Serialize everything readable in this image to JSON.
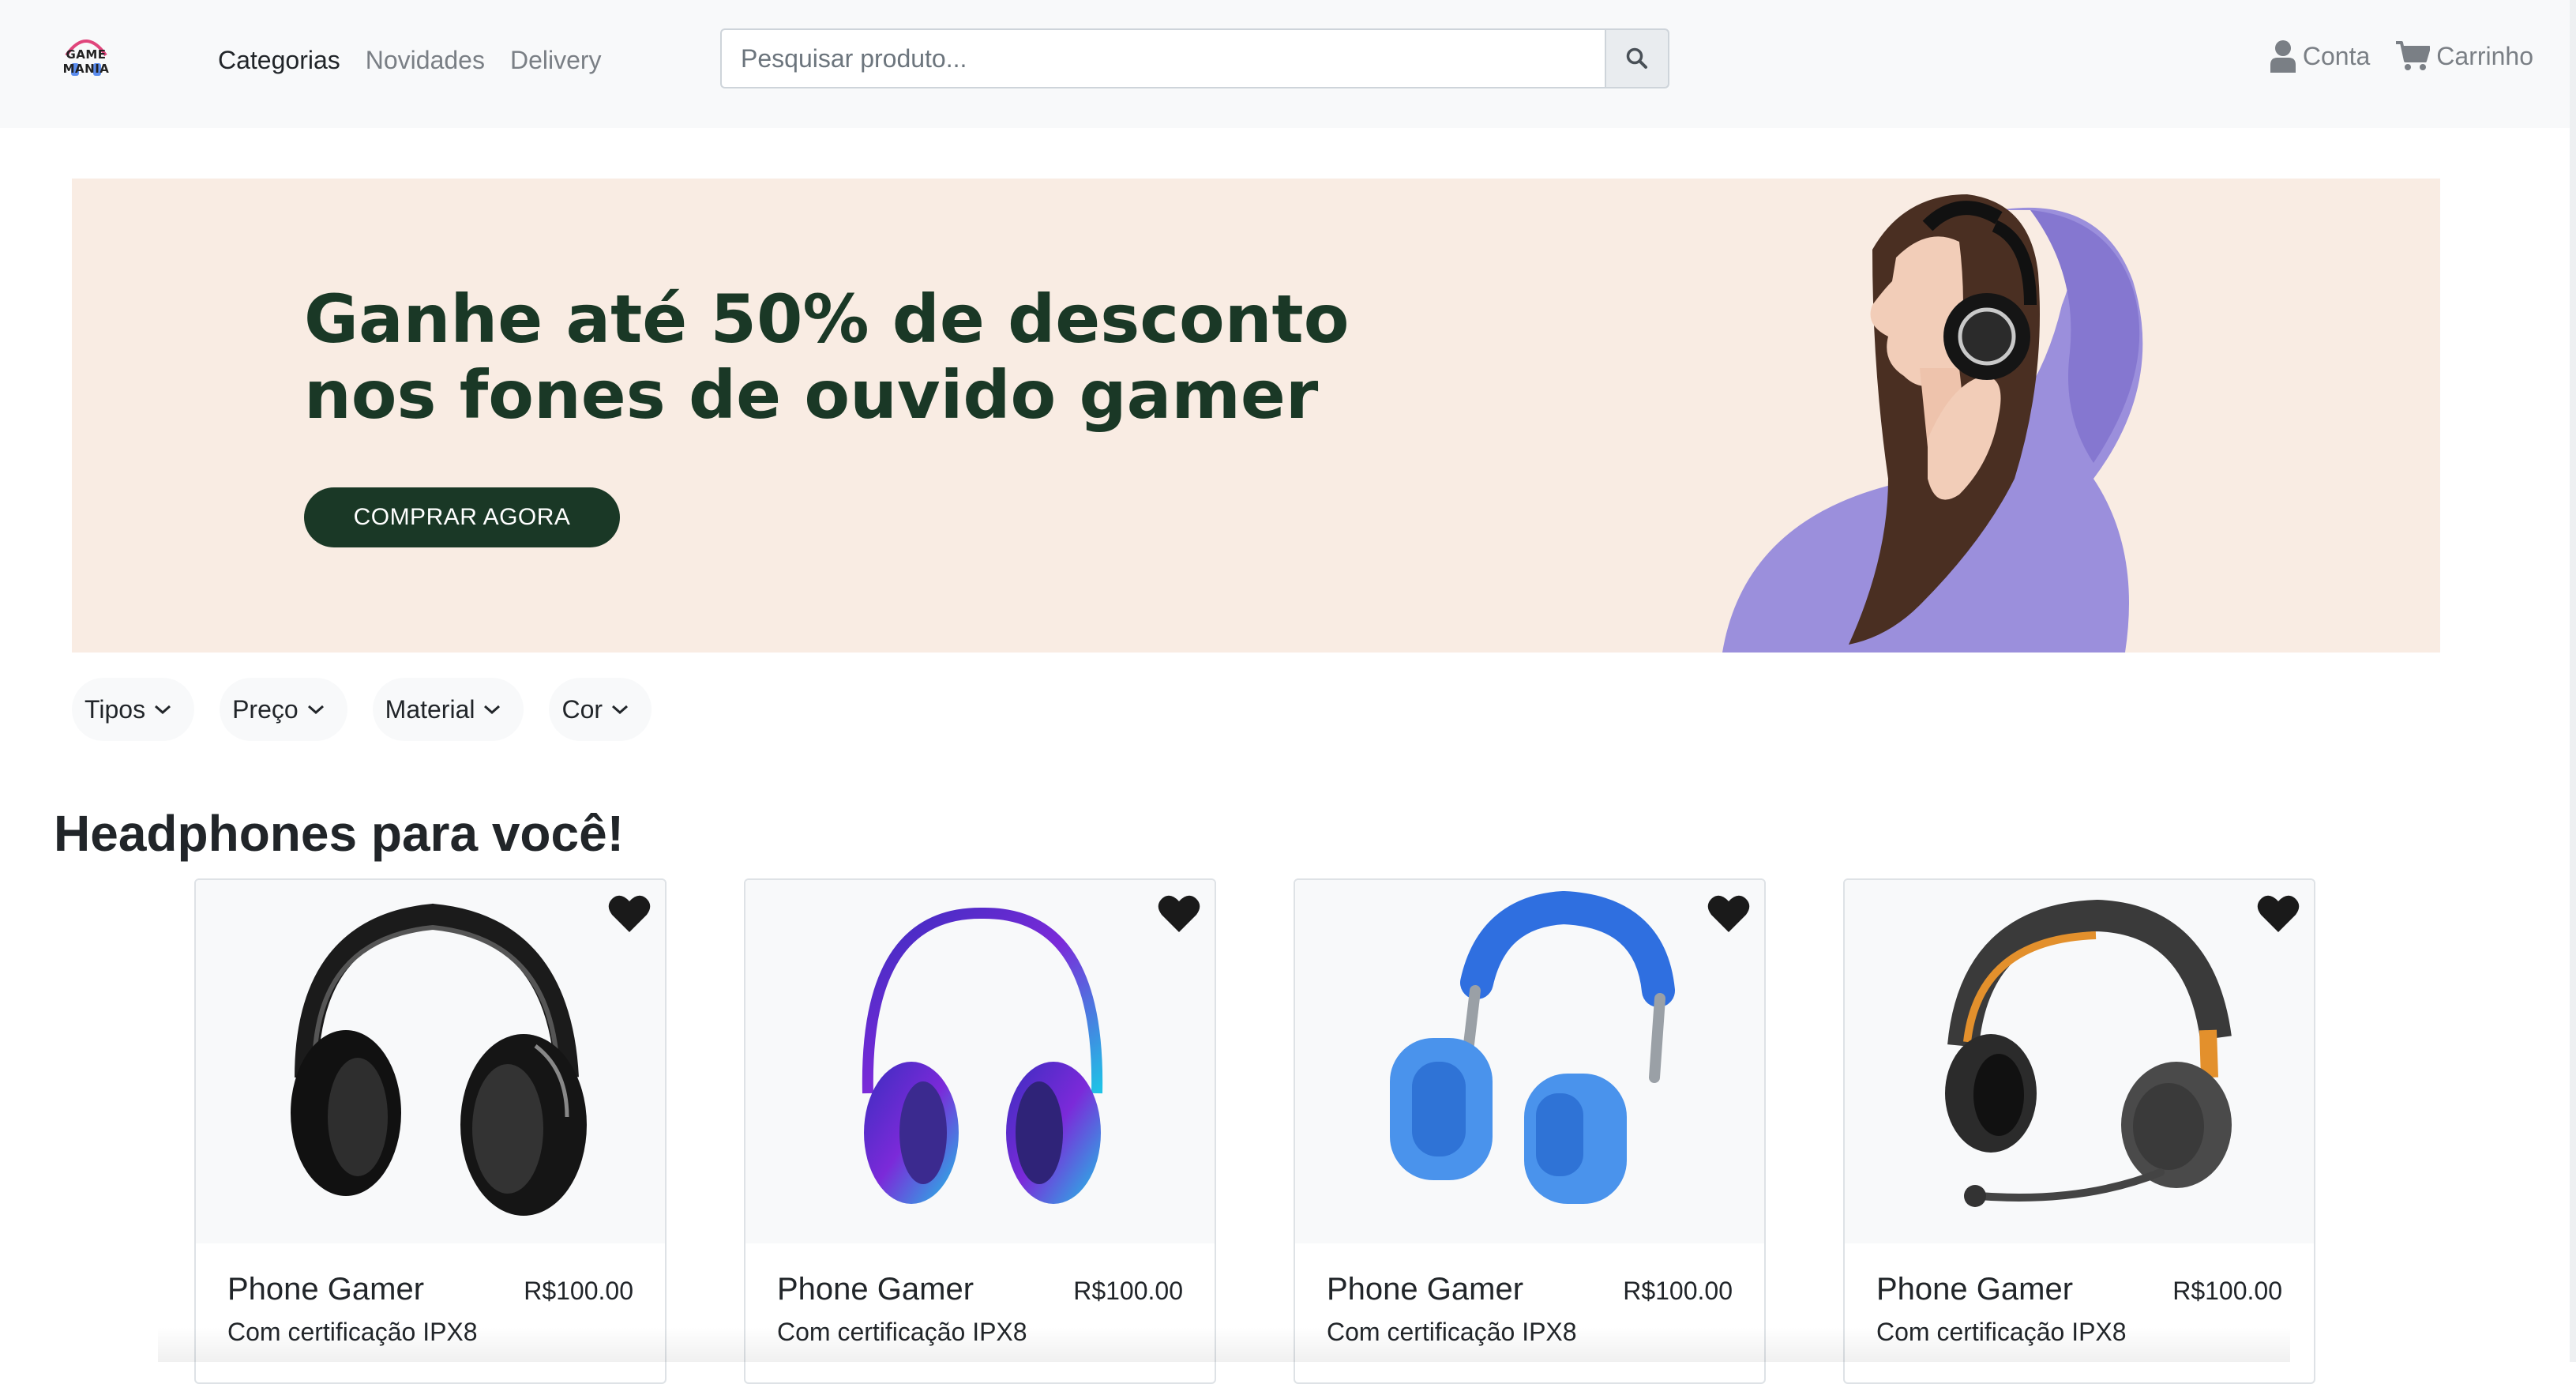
{
  "brand": {
    "logo_text": "GAME MANIA"
  },
  "nav": {
    "links": [
      {
        "label": "Categorias",
        "active": true
      },
      {
        "label": "Novidades",
        "active": false
      },
      {
        "label": "Delivery",
        "active": false
      }
    ],
    "search_placeholder": "Pesquisar produto...",
    "account_label": "Conta",
    "cart_label": "Carrinho"
  },
  "hero": {
    "title": "Ganhe até 50% de desconto\nnos fones de ouvido gamer",
    "button_label": "COMPRAR AGORA"
  },
  "filters": [
    {
      "label": "Tipos"
    },
    {
      "label": "Preço"
    },
    {
      "label": "Material"
    },
    {
      "label": "Cor"
    }
  ],
  "section_title": "Headphones para você!",
  "products": [
    {
      "name": "Phone Gamer",
      "price": "R$100.00",
      "desc": "Com certificação IPX8",
      "icon": "black-headphones"
    },
    {
      "name": "Phone Gamer",
      "price": "R$100.00",
      "desc": "Com certificação IPX8",
      "icon": "purple-headphones"
    },
    {
      "name": "Phone Gamer",
      "price": "R$100.00",
      "desc": "Com certificação IPX8",
      "icon": "blue-headphones"
    },
    {
      "name": "Phone Gamer",
      "price": "R$100.00",
      "desc": "Com certificação IPX8",
      "icon": "headset-with-mic"
    }
  ],
  "colors": {
    "brand_dark_green": "#1a3826",
    "hero_bg": "#f9ece3",
    "navbar_bg": "#f8f9fa"
  }
}
